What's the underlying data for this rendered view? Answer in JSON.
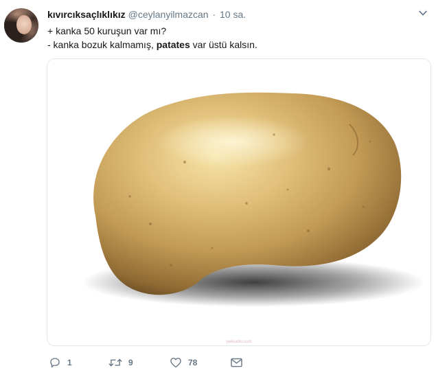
{
  "tweet": {
    "display_name": "kıvırcıksaçlıklıkız",
    "handle": "@ceylanyilmazcan",
    "separator": "·",
    "time": "10 sa.",
    "line1": "+ kanka 50 kuruşun var mı?",
    "line2_before": "- kanka bozuk kalmamış, ",
    "line2_bold": "patates",
    "line2_after": " var üstü kalsın.",
    "media_watermark": "pekkadin.com",
    "media_subject": "potato"
  },
  "actions": {
    "reply_count": "1",
    "retweet_count": "9",
    "like_count": "78"
  },
  "icons": {
    "more": "chevron-down-icon",
    "reply": "reply-icon",
    "retweet": "retweet-icon",
    "like": "heart-icon",
    "dm": "envelope-icon"
  },
  "colors": {
    "text": "#14171a",
    "secondary": "#657786",
    "border": "#e1e8ed"
  }
}
